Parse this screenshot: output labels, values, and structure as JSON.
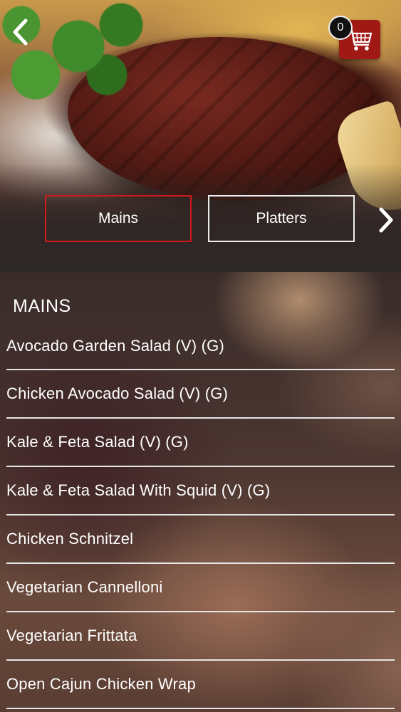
{
  "header": {
    "cart_count": "0",
    "back_icon": "chevron-left-icon",
    "cart_icon": "shopping-cart-icon",
    "next_icon": "chevron-right-icon",
    "accent_color": "#a11915"
  },
  "tabs": [
    {
      "label": "Mains",
      "selected": true
    },
    {
      "label": "Platters",
      "selected": false
    }
  ],
  "section": {
    "title": "MAINS"
  },
  "items": [
    {
      "label": "Avocado Garden Salad (V) (G)"
    },
    {
      "label": "Chicken Avocado Salad (V) (G)"
    },
    {
      "label": "Kale & Feta Salad (V) (G)"
    },
    {
      "label": "Kale & Feta Salad With Squid (V) (G)"
    },
    {
      "label": "Chicken Schnitzel"
    },
    {
      "label": "Vegetarian Cannelloni"
    },
    {
      "label": "Vegetarian Frittata"
    },
    {
      "label": "Open Cajun Chicken Wrap"
    }
  ]
}
